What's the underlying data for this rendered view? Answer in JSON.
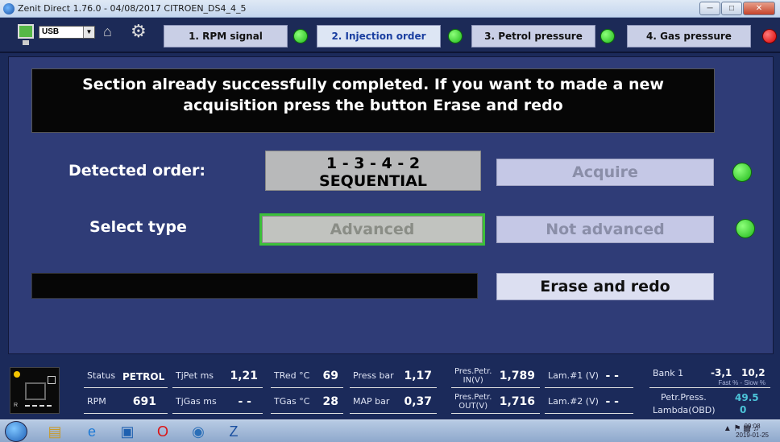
{
  "window": {
    "title": "Zenit Direct 1.76.0 - 04/08/2017    CITROEN_DS4_4_5"
  },
  "toolbar": {
    "port_select": "USB",
    "steps": [
      {
        "label": "1. RPM signal",
        "status": "green"
      },
      {
        "label": "2. Injection order",
        "status": "green"
      },
      {
        "label": "3. Petrol pressure",
        "status": "green"
      },
      {
        "label": "4. Gas pressure",
        "status": "red"
      }
    ]
  },
  "main": {
    "message_line1": "Section already successfully completed. If you want to made a new",
    "message_line2": "acquisition press the button Erase and redo",
    "detected_order_label": "Detected order:",
    "detected_order_value": "1 - 3 - 4 - 2",
    "detected_order_type": "SEQUENTIAL",
    "acquire_label": "Acquire",
    "select_type_label": "Select type",
    "advanced_label": "Advanced",
    "not_advanced_label": "Not advanced",
    "erase_label": "Erase and redo"
  },
  "status": {
    "status_label": "Status",
    "status_value": "PETROL",
    "rpm_label": "RPM",
    "rpm_value": "691",
    "tjpet_label": "TjPet ms",
    "tjpet_value": "1,21",
    "tjgas_label": "TjGas ms",
    "tjgas_value": "- -",
    "tred_label": "TRed °C",
    "tred_value": "69",
    "tgas_label": "TGas °C",
    "tgas_value": "28",
    "press_label": "Press bar",
    "press_value": "1,17",
    "map_label": "MAP bar",
    "map_value": "0,37",
    "pres_in_label_1": "Pres.Petr.",
    "pres_in_label_2": "IN(V)",
    "pres_in_value": "1,789",
    "pres_out_label_1": "Pres.Petr.",
    "pres_out_label_2": "OUT(V)",
    "pres_out_value": "1,716",
    "lam1_label": "Lam.#1 (V)",
    "lam1_value": "- -",
    "lam2_label": "Lam.#2 (V)",
    "lam2_value": "- -",
    "bank_label": "Bank 1",
    "bank_fast": "-3,1",
    "bank_slow": "10,2",
    "bank_note": "Fast % - Slow %",
    "petr_press_label": "Petr.Press.",
    "petr_press_value": "49.5",
    "lambda_label": "Lambda(OBD)",
    "lambda_value": "0"
  },
  "taskbar": {
    "time": "09:08",
    "date": "2019-01-25"
  }
}
